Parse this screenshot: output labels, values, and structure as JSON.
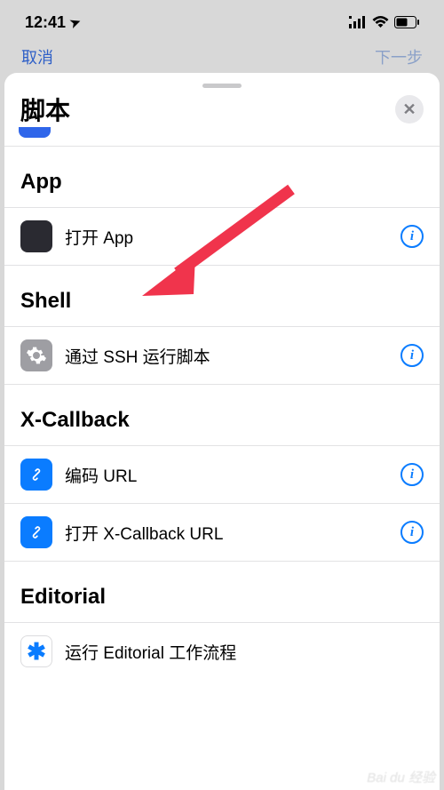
{
  "status": {
    "time": "12:41",
    "location_glyph": "➤"
  },
  "nav": {
    "cancel": "取消",
    "next": "下一步"
  },
  "sheet": {
    "title": "脚本",
    "close_glyph": "✕"
  },
  "sections": {
    "app": {
      "header": "App",
      "open_app": "打开 App"
    },
    "shell": {
      "header": "Shell",
      "ssh_script": "通过 SSH 运行脚本"
    },
    "xcallback": {
      "header": "X-Callback",
      "encode_url": "编码 URL",
      "open_xcallback": "打开 X-Callback URL"
    },
    "editorial": {
      "header": "Editorial",
      "run_workflow": "运行 Editorial 工作流程"
    }
  },
  "info_glyph": "i",
  "watermark": "Bai du 经验"
}
